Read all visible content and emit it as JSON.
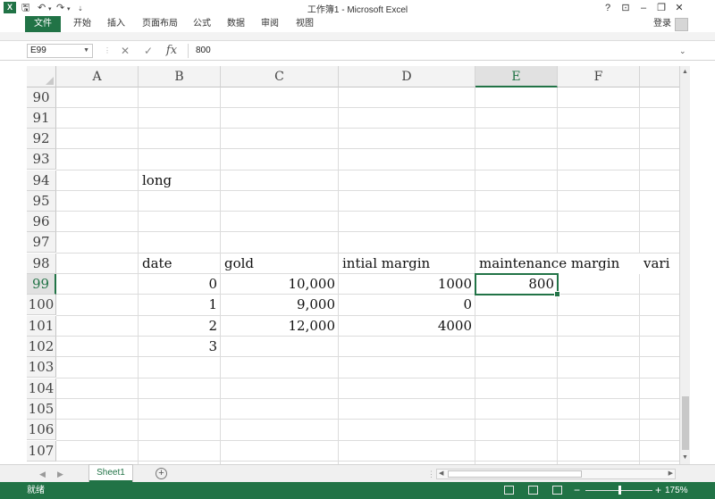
{
  "window": {
    "title": "工作簿1 - Microsoft Excel",
    "logo": "X",
    "quick_access": [
      "save-icon",
      "undo-icon",
      "redo-icon"
    ],
    "controls": [
      "help-icon",
      "ribbon-display-icon",
      "minimize-icon",
      "restore-icon",
      "close-icon"
    ]
  },
  "ribbon": {
    "file_tab": "文件",
    "tabs": [
      "开始",
      "插入",
      "页面布局",
      "公式",
      "数据",
      "审阅",
      "视图"
    ],
    "login": "登录"
  },
  "formula_bar": {
    "name_box": "E99",
    "fx_label": "fx",
    "value": "800"
  },
  "columns": [
    "A",
    "B",
    "C",
    "D",
    "E",
    "F"
  ],
  "active_column": "E",
  "rows": [
    "90",
    "91",
    "92",
    "93",
    "94",
    "95",
    "96",
    "97",
    "98",
    "99",
    "100",
    "101",
    "102",
    "103",
    "104",
    "105",
    "106",
    "107"
  ],
  "active_row": "99",
  "cells": {
    "B94": "long",
    "B98": "date",
    "C98": "gold",
    "D98": "intial margin",
    "E98": "maintenance margin",
    "G98": "vari",
    "B99": "0",
    "C99": "10,000",
    "D99": "1000",
    "E99": "800",
    "B100": "1",
    "C100": "9,000",
    "D100": "0",
    "B101": "2",
    "C101": "12,000",
    "D101": "4000",
    "B102": "3"
  },
  "sheets": {
    "tabs": [
      "Sheet1"
    ],
    "active": "Sheet1"
  },
  "status": {
    "text": "就绪",
    "zoom": "175%"
  },
  "colors": {
    "accent": "#217346"
  }
}
